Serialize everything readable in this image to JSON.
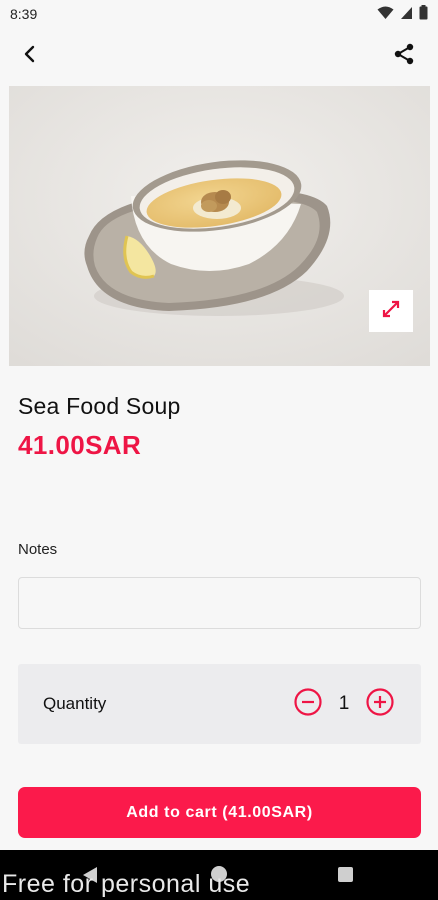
{
  "status_bar": {
    "time": "8:39"
  },
  "product": {
    "title": "Sea Food Soup",
    "price": "41.00SAR"
  },
  "notes": {
    "label": "Notes",
    "value": "",
    "placeholder": ""
  },
  "quantity": {
    "label": "Quantity",
    "value": "1"
  },
  "cart_button": {
    "label": "Add to cart (41.00SAR)"
  },
  "watermark": "Free for personal use",
  "colors": {
    "accent": "#fb1a4b",
    "price": "#ee1545",
    "background": "#f7f7f7",
    "quantity_panel": "#ececee"
  },
  "icons": [
    "back-arrow-icon",
    "share-icon",
    "expand-icon",
    "minus-circle-icon",
    "plus-circle-icon",
    "wifi-icon",
    "cellular-icon",
    "battery-icon"
  ]
}
